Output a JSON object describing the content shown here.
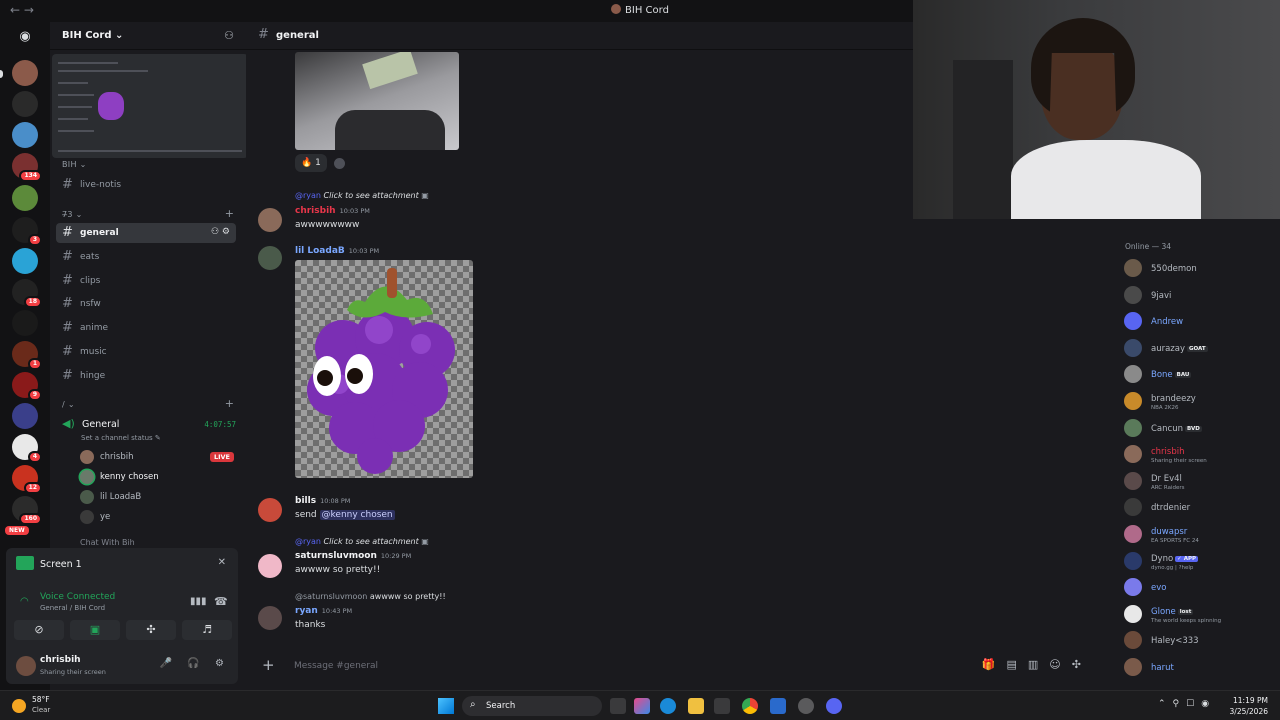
{
  "window": {
    "title": "BIH Cord",
    "nav_back": "←",
    "nav_fwd": "→"
  },
  "guild_badges": [
    "134",
    "3",
    "18",
    "1",
    "9",
    "4",
    "12",
    "160"
  ],
  "guild_new": "NEW",
  "server": {
    "name": "BIH Cord",
    "chevron": "⌄"
  },
  "sidebar": {
    "categories": [
      "BIH ⌄",
      "7̶3 ⌄",
      "/ ⌄"
    ],
    "channels": [
      {
        "label": "live-notis"
      },
      {
        "label": "general"
      },
      {
        "label": "eats"
      },
      {
        "label": "clips"
      },
      {
        "label": "nsfw"
      },
      {
        "label": "anime"
      },
      {
        "label": "music"
      },
      {
        "label": "hinge"
      }
    ],
    "voice_channel": {
      "label": "General",
      "timer": "4:07:57",
      "status": "Set a channel status ✎"
    },
    "voice_users": [
      {
        "name": "chrisbih",
        "live": "LIVE"
      },
      {
        "name": "kenny chosen"
      },
      {
        "name": "lil LoadaB"
      },
      {
        "name": "ye"
      }
    ],
    "cut_channel": "Chat With Bih"
  },
  "panel": {
    "screen_title": "Screen 1",
    "voice_connected": "Voice Connected",
    "voice_sub": "General / BIH Cord",
    "user_name": "chrisbih",
    "user_status": "Sharing their screen"
  },
  "channel": {
    "name": "general"
  },
  "messages": {
    "reaction": {
      "emoji": "🔥",
      "count": "1"
    },
    "m1": {
      "reply_handle": "@ryan",
      "reply_text": "Click to see attachment",
      "author": "chrisbih",
      "time": "10:03 PM",
      "text": "awwwwwwww"
    },
    "m2": {
      "author": "lil LoadaB",
      "time": "10:03 PM"
    },
    "m3": {
      "author": "bills",
      "time": "10:08 PM",
      "text": "send ",
      "mention": "@kenny chosen"
    },
    "m4": {
      "reply_handle": "@ryan",
      "reply_text": "Click to see attachment",
      "author": "saturnsluvmoon",
      "time": "10:29 PM",
      "text": "awwww so pretty!!"
    },
    "m5": {
      "reply_handle": "@saturnsluvmoon",
      "reply_text": "awwww so pretty!!",
      "author": "ryan",
      "time": "10:43 PM",
      "text": "thanks"
    }
  },
  "composer": {
    "placeholder": "Message #general"
  },
  "members": {
    "header": "Online — 34",
    "list": [
      {
        "name": "550demon",
        "color": "#b5bac1",
        "tag": ""
      },
      {
        "name": "9javi",
        "color": "#b5bac1"
      },
      {
        "name": "Andrew",
        "color": "#7aa7ff"
      },
      {
        "name": "aurazay",
        "color": "#b5bac1",
        "tag": "GOAT"
      },
      {
        "name": "Bone",
        "color": "#7aa7ff",
        "tag": "BAU"
      },
      {
        "name": "brandeezy",
        "color": "#b5bac1",
        "sub": "NBA 2K26"
      },
      {
        "name": "Cancun",
        "color": "#b5bac1",
        "tag": "BVD"
      },
      {
        "name": "chrisbih",
        "color": "#e8364a",
        "sub": "Sharing their screen"
      },
      {
        "name": "Dr Ev4l",
        "color": "#b5bac1",
        "sub": "ARC Raiders"
      },
      {
        "name": "dtrdenier",
        "color": "#b5bac1"
      },
      {
        "name": "duwapsr",
        "color": "#7aa7ff",
        "sub": "EA SPORTS FC 24"
      },
      {
        "name": "Dyno",
        "color": "#b5bac1",
        "tag": "✓ APP",
        "sub": "dyno.gg | ?help"
      },
      {
        "name": "evo",
        "color": "#7aa7ff"
      },
      {
        "name": "Glone",
        "color": "#7aa7ff",
        "tag": "lost",
        "sub": "The world keeps spinning"
      },
      {
        "name": "Haley<333",
        "color": "#b5bac1"
      },
      {
        "name": "harut",
        "color": "#7aa7ff"
      }
    ]
  },
  "taskbar": {
    "temp": "58°F",
    "condition": "Clear",
    "search": "Search",
    "time": "11:19 PM",
    "date": "3/25/2026"
  }
}
